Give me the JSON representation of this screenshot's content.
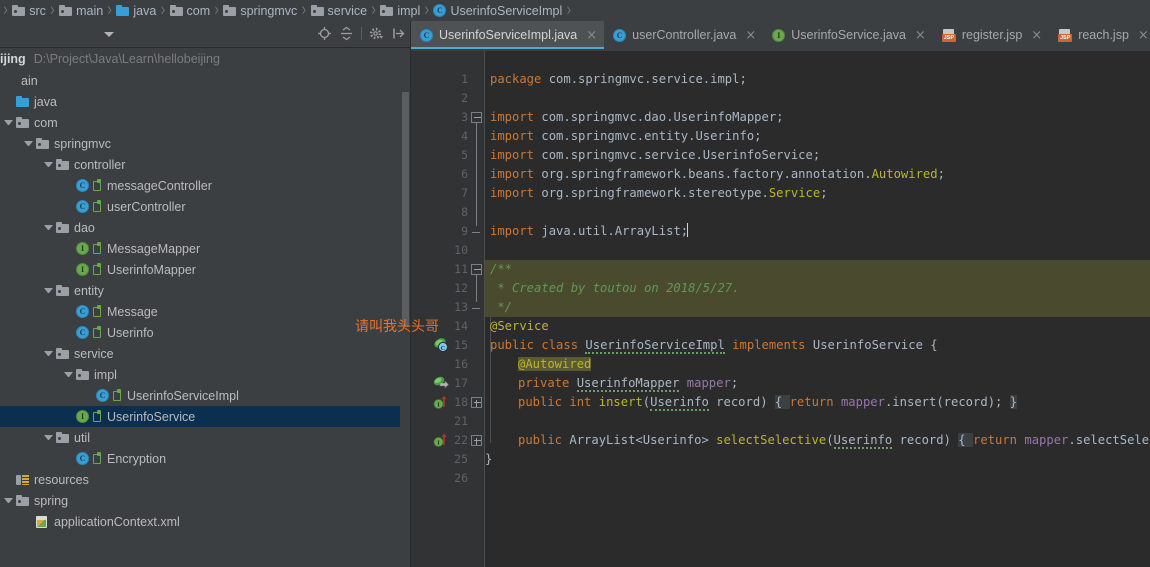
{
  "breadcrumb": {
    "items": [
      {
        "label": "src",
        "icon": "folder-icon",
        "kind": "folder"
      },
      {
        "label": "main",
        "icon": "folder-icon",
        "kind": "folder"
      },
      {
        "label": "java",
        "icon": "folder-blue-icon",
        "kind": "folder-source"
      },
      {
        "label": "com",
        "icon": "folder-icon",
        "kind": "folder"
      },
      {
        "label": "springmvc",
        "icon": "folder-icon",
        "kind": "folder"
      },
      {
        "label": "service",
        "icon": "folder-icon",
        "kind": "folder"
      },
      {
        "label": "impl",
        "icon": "folder-icon",
        "kind": "folder"
      },
      {
        "label": "UserinfoServiceImpl",
        "icon": "class-icon",
        "kind": "class"
      }
    ],
    "separator": "›"
  },
  "project_panel": {
    "toolbar": {
      "dropdown_caret": "chevron-down-icon",
      "icons": [
        {
          "name": "locate-target-icon",
          "title": "Select Opened File"
        },
        {
          "name": "collapse-all-icon",
          "title": "Collapse All"
        },
        {
          "name": "gear-settings-icon",
          "title": "Settings"
        },
        {
          "name": "hide-panel-icon",
          "title": "Hide"
        }
      ]
    },
    "project_name": "ijing",
    "project_path": "D:\\Project\\Java\\Learn\\hellobeijing",
    "tree": [
      {
        "label": "ain",
        "indent": 0,
        "twist": "none",
        "icon": "none",
        "selected": false,
        "kind": "plain"
      },
      {
        "label": "java",
        "indent": 0,
        "twist": "none",
        "icon": "folder-blue-icon",
        "selected": false,
        "kind": "folder-source"
      },
      {
        "label": "com",
        "indent": 0,
        "twist": "down",
        "icon": "folder-icon",
        "selected": false,
        "kind": "folder"
      },
      {
        "label": "springmvc",
        "indent": 1,
        "twist": "down",
        "icon": "folder-icon",
        "selected": false,
        "kind": "folder"
      },
      {
        "label": "controller",
        "indent": 2,
        "twist": "down",
        "icon": "folder-icon",
        "selected": false,
        "kind": "folder"
      },
      {
        "label": "messageController",
        "indent": 3,
        "twist": "none",
        "icon": "class-icon",
        "selected": false,
        "kind": "class"
      },
      {
        "label": "userController",
        "indent": 3,
        "twist": "none",
        "icon": "class-icon",
        "selected": false,
        "kind": "class"
      },
      {
        "label": "dao",
        "indent": 2,
        "twist": "down",
        "icon": "folder-icon",
        "selected": false,
        "kind": "folder"
      },
      {
        "label": "MessageMapper",
        "indent": 3,
        "twist": "none",
        "icon": "interface-icon",
        "selected": false,
        "kind": "interface"
      },
      {
        "label": "UserinfoMapper",
        "indent": 3,
        "twist": "none",
        "icon": "interface-icon",
        "selected": false,
        "kind": "interface"
      },
      {
        "label": "entity",
        "indent": 2,
        "twist": "down",
        "icon": "folder-icon",
        "selected": false,
        "kind": "folder"
      },
      {
        "label": "Message",
        "indent": 3,
        "twist": "none",
        "icon": "class-icon",
        "selected": false,
        "kind": "class"
      },
      {
        "label": "Userinfo",
        "indent": 3,
        "twist": "none",
        "icon": "class-icon",
        "selected": false,
        "kind": "class"
      },
      {
        "label": "service",
        "indent": 2,
        "twist": "down",
        "icon": "folder-icon",
        "selected": false,
        "kind": "folder"
      },
      {
        "label": "impl",
        "indent": 3,
        "twist": "down",
        "icon": "folder-icon",
        "selected": false,
        "kind": "folder"
      },
      {
        "label": "UserinfoServiceImpl",
        "indent": 4,
        "twist": "none",
        "icon": "class-icon",
        "selected": false,
        "kind": "class"
      },
      {
        "label": "UserinfoService",
        "indent": 3,
        "twist": "none",
        "icon": "interface-icon",
        "selected": true,
        "kind": "interface"
      },
      {
        "label": "util",
        "indent": 2,
        "twist": "down",
        "icon": "folder-icon",
        "selected": false,
        "kind": "folder"
      },
      {
        "label": "Encryption",
        "indent": 3,
        "twist": "none",
        "icon": "class-icon",
        "selected": false,
        "kind": "class"
      },
      {
        "label": "resources",
        "indent": 0,
        "twist": "none",
        "icon": "resources-icon",
        "selected": false,
        "kind": "resources"
      },
      {
        "label": "spring",
        "indent": 0,
        "twist": "down",
        "icon": "folder-icon",
        "selected": false,
        "kind": "folder"
      },
      {
        "label": "applicationContext.xml",
        "indent": 1,
        "twist": "none",
        "icon": "xml-file-icon",
        "selected": false,
        "kind": "xml"
      }
    ]
  },
  "tabs": [
    {
      "label": "UserinfoServiceImpl.java",
      "icon": "class-icon",
      "active": true,
      "close": "×"
    },
    {
      "label": "userController.java",
      "icon": "class-icon",
      "active": false,
      "close": "×"
    },
    {
      "label": "UserinfoService.java",
      "icon": "interface-icon",
      "active": false,
      "close": "×"
    },
    {
      "label": "register.jsp",
      "icon": "jsp-file-icon",
      "active": false,
      "close": "×"
    },
    {
      "label": "reach.jsp",
      "icon": "jsp-file-icon",
      "active": false,
      "close": "×"
    }
  ],
  "editor": {
    "watermark": "请叫我头头哥",
    "line_numbers": [
      1,
      2,
      3,
      4,
      5,
      6,
      7,
      8,
      9,
      10,
      11,
      12,
      13,
      14,
      15,
      16,
      17,
      18,
      21,
      22,
      25,
      26
    ],
    "lines": {
      "l1_kw": "package",
      "l1_rest": " com.springmvc.service.impl;",
      "l3_kw": "import",
      "l3_rest": " com.springmvc.dao.UserinfoMapper;",
      "l4_kw": "import",
      "l4_rest": " com.springmvc.entity.Userinfo;",
      "l5_kw": "import",
      "l5_rest": " com.springmvc.service.UserinfoService;",
      "l6_kw": "import",
      "l6_rest": " org.springframework.beans.factory.annotation.",
      "l6_ann": "Autowired",
      "l6_semi": ";",
      "l7_kw": "import",
      "l7_rest": " org.springframework.stereotype.",
      "l7_ann": "Service",
      "l7_semi": ";",
      "l9_kw": "import",
      "l9_rest": " java.util.ArrayList;",
      "l11": "/**",
      "l12": " * Created by toutou on 2018/5/27.",
      "l13": " */",
      "l14_ann": "@Service",
      "l15_kw1": "public class ",
      "l15_name": "UserinfoServiceImpl",
      "l15_kw2": " implements ",
      "l15_iface": "UserinfoService",
      "l15_brace": " {",
      "l16_ann": "@Autowired",
      "l17_kw": "private ",
      "l17_type": "UserinfoMapper",
      "l17_field": " mapper",
      "l17_semi": ";",
      "l18_kw1": "public ",
      "l18_kw2": "int ",
      "l18_name": "insert",
      "l18_p1": "(",
      "l18_ptype": "Userinfo",
      "l18_pname": " record",
      "l18_p2": ") ",
      "l18_open": "{ ",
      "l18_ret": "return ",
      "l18_body": "mapper",
      "l18_body2": ".insert(record)",
      "l18_semi": "; ",
      "l18_close": "}",
      "l22_kw1": "public ",
      "l22_type": "ArrayList<Userinfo> ",
      "l22_name": "selectSelective",
      "l22_p1": "(",
      "l22_ptype": "Userinfo",
      "l22_pname": " record",
      "l22_p2": ") ",
      "l22_open": "{ ",
      "l22_ret": "return ",
      "l22_body": "mapper",
      "l22_body2": ".selectSelective(record)",
      "l22_semi": "; ",
      "l22_close": "}",
      "l25": "}"
    },
    "gutter_icons": [
      {
        "line": 15,
        "name": "spring-bean-icon"
      },
      {
        "line": 17,
        "name": "spring-autowired-icon"
      },
      {
        "line": 17,
        "name": "implementing-method-icon"
      },
      {
        "line": 22,
        "name": "implementing-method-icon"
      }
    ]
  },
  "colors": {
    "chrome_bg": "#3c3f41",
    "editor_bg": "#2b2b2b",
    "gutter_bg": "#313335",
    "accent_cyan": "#4eaace",
    "selection_navy": "#0d2f4f",
    "keyword_orange": "#cc7832",
    "annotation_yellow": "#bbb529",
    "comment_green": "#629755",
    "field_purple": "#9876aa",
    "text_main": "#a9b7c6",
    "watermark_orange": "#e8732c"
  }
}
